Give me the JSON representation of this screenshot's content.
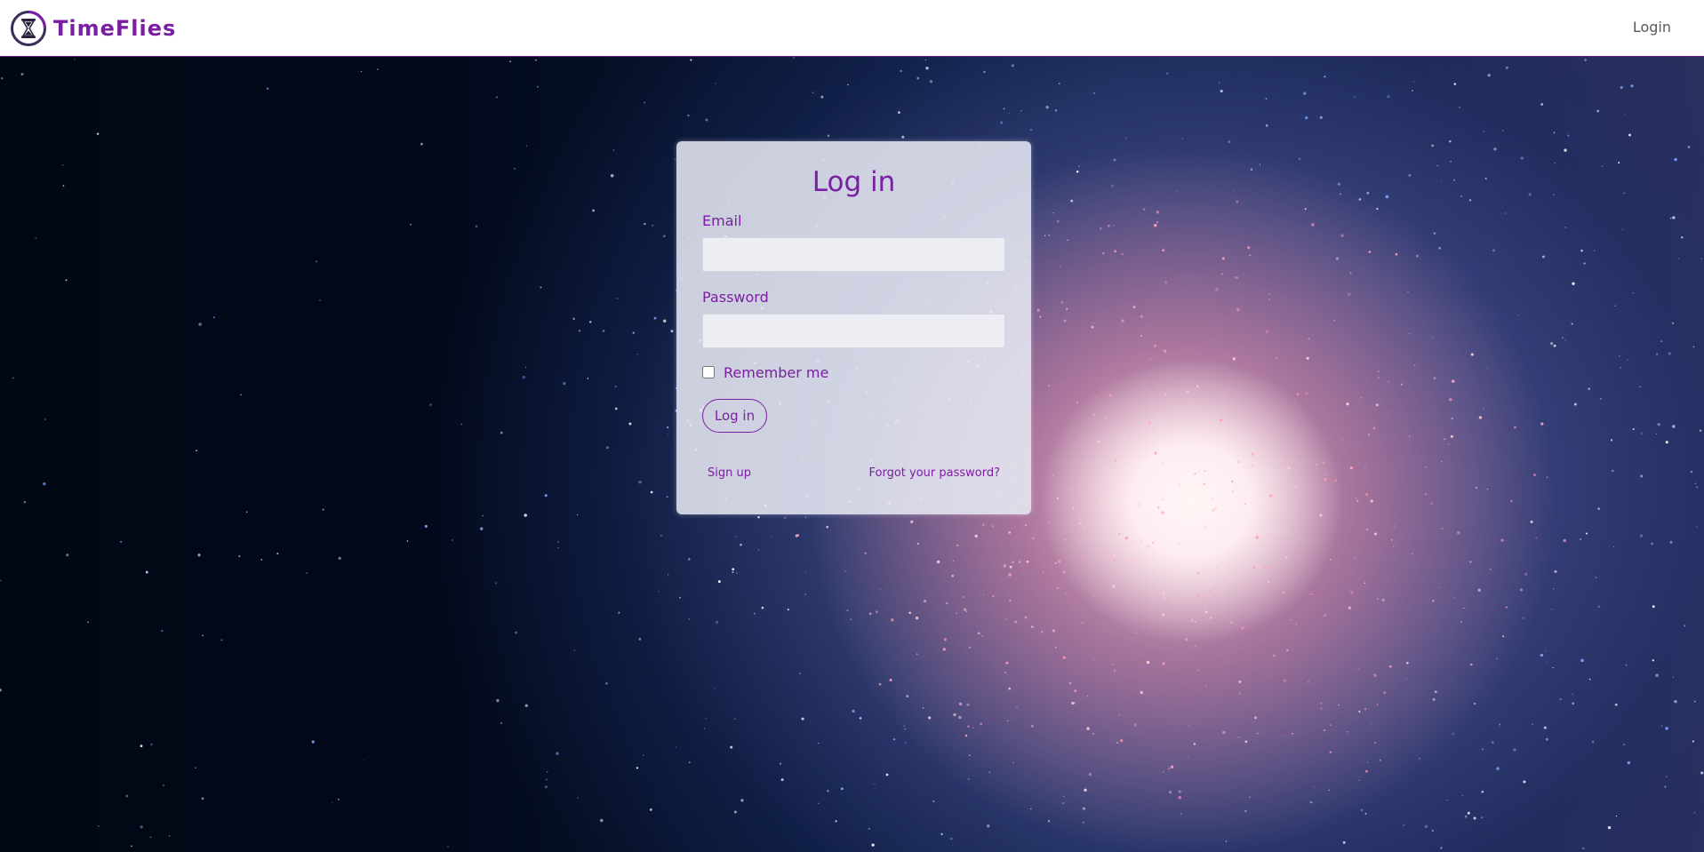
{
  "navbar": {
    "brand_name": "TimeFlies",
    "brand_icon": "hourglass-icon",
    "login_label": "Login"
  },
  "login_form": {
    "title": "Log in",
    "email_label": "Email",
    "email_value": "",
    "password_label": "Password",
    "password_value": "",
    "remember_label": "Remember me",
    "remember_checked": false,
    "submit_label": "Log in",
    "signup_link": "Sign up",
    "forgot_link": "Forgot your password?"
  },
  "colors": {
    "accent": "#7b1fa2",
    "navbar_bg": "#ffffff",
    "card_bg": "#e6e8f2",
    "nav_text": "#555a60"
  }
}
